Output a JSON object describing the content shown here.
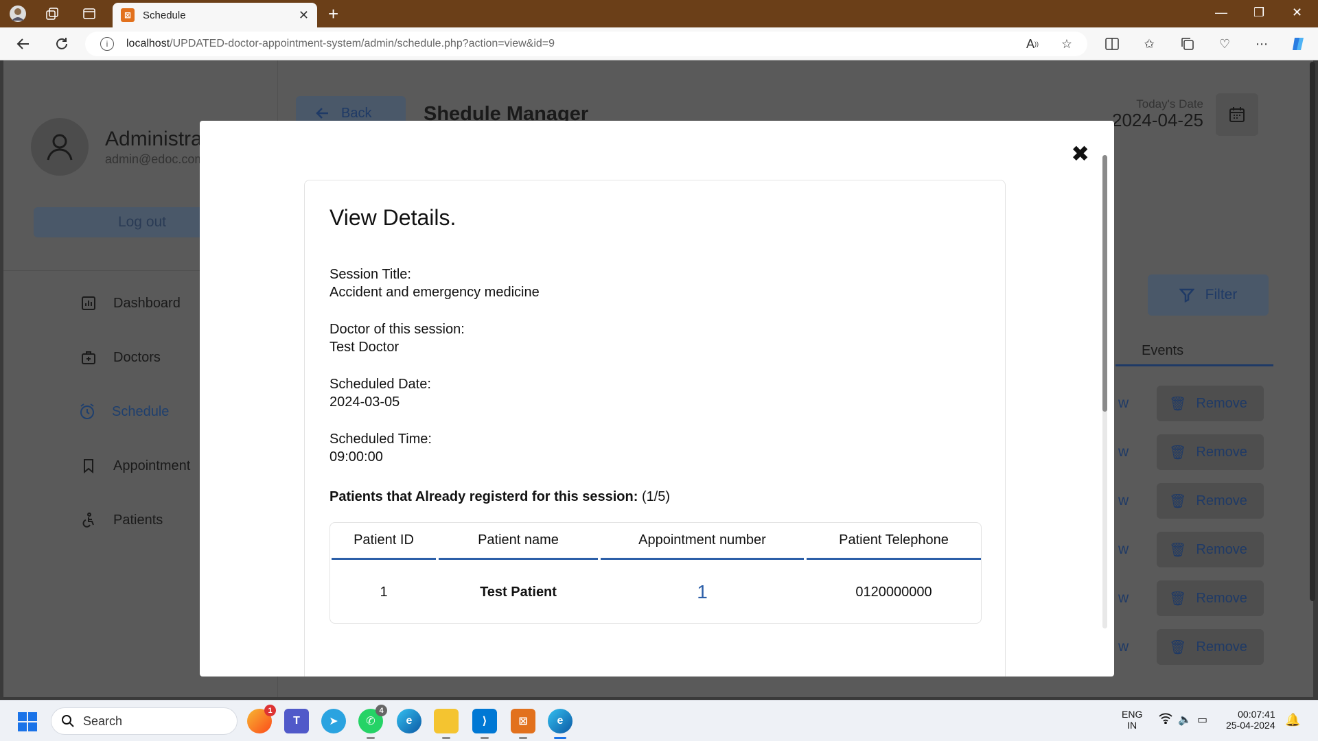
{
  "browser": {
    "tab_title": "Schedule",
    "url_host": "localhost",
    "url_path": "/UPDATED-doctor-appointment-system/admin/schedule.php?action=view&id=9"
  },
  "sidebar": {
    "admin_name": "Administrator",
    "admin_email": "admin@edoc.com",
    "logout_label": "Log out",
    "menu": [
      {
        "label": "Dashboard",
        "icon": "dashboard-icon"
      },
      {
        "label": "Doctors",
        "icon": "doctor-icon"
      },
      {
        "label": "Schedule",
        "icon": "schedule-icon",
        "active": true
      },
      {
        "label": "Appointment",
        "icon": "bookmark-icon"
      },
      {
        "label": "Patients",
        "icon": "patient-icon"
      }
    ]
  },
  "header": {
    "back_label": "Back",
    "page_title": "Shedule Manager",
    "today_label": "Today's Date",
    "today_date": "2024-04-25"
  },
  "background": {
    "filter_label": "Filter",
    "events_header": "Events",
    "row_action_fragment": "w",
    "remove_label": "Remove"
  },
  "modal": {
    "heading": "View Details.",
    "session_title_label": "Session Title:",
    "session_title": "Accident and emergency medicine",
    "doctor_label": "Doctor of this session:",
    "doctor": "Test Doctor",
    "date_label": "Scheduled Date:",
    "date": "2024-03-05",
    "time_label": "Scheduled Time:",
    "time": "09:00:00",
    "registered_label": "Patients that Already registerd for this session:",
    "registered_count": "(1/5)",
    "table": {
      "headers": [
        "Patient ID",
        "Patient name",
        "Appointment number",
        "Patient Telephone"
      ],
      "rows": [
        {
          "id": "1",
          "name": "Test Patient",
          "appointment": "1",
          "telephone": "0120000000"
        }
      ]
    }
  },
  "taskbar": {
    "search_placeholder": "Search",
    "badge_1": "1",
    "badge_2": "4",
    "lang_top": "ENG",
    "lang_bottom": "IN",
    "time": "00:07:41",
    "date": "25-04-2024"
  }
}
